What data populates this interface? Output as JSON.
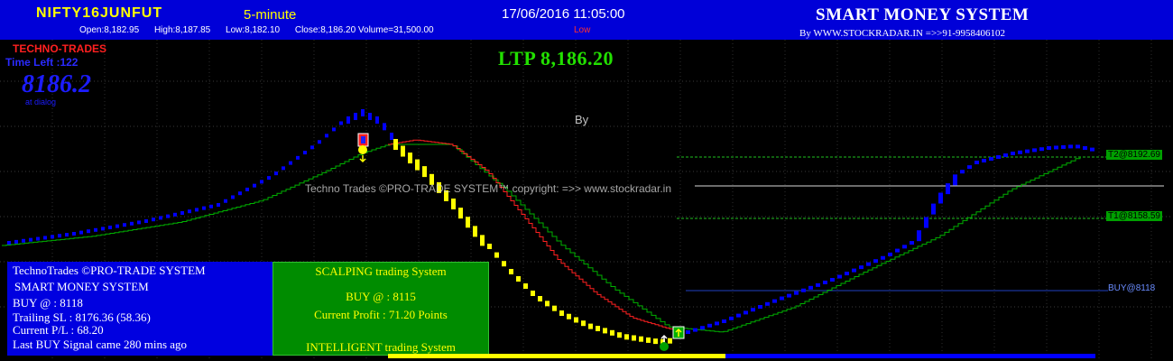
{
  "header": {
    "symbol": "NIFTY16JUNFUT",
    "timeframe": "5-minute",
    "datetime": "17/06/2016 11:05:00",
    "brand": "SMART MONEY SYSTEM",
    "open": "Open:8,182.95",
    "high": "High:8,187.85",
    "low": "Low:8,182.10",
    "close_volume": "Close:8,186.20 Volume=31,500.00",
    "low_tag": "Low",
    "website": "By WWW.STOCKRADAR.IN =>>91-9958406102"
  },
  "overlay": {
    "techno_trades": "TECHNO-TRADES",
    "time_left": "Time Left :122",
    "big_price": "8186.2",
    "small_tag": "at dialog",
    "ltp": "LTP 8,186.20",
    "by_label": "By",
    "copyright": "Techno Trades ©PRO-TRADE SYSTEM™ copyright: =>> www.stockradar.in"
  },
  "levels": {
    "t2": "T2@8192.69",
    "t1": "T1@8158.59",
    "buy": "BUY@8118"
  },
  "panel_left": {
    "line1": "TechnoTrades ©PRO-TRADE SYSTEM",
    "line2": "SMART MONEY SYSTEM",
    "line3": "BUY @ : 8118",
    "line4": "Trailing SL : 8176.36 (58.36)",
    "line5": "Current P/L : 68.20",
    "line6": "Last BUY Signal came 280 mins ago"
  },
  "panel_mid": {
    "line1": "SCALPING trading System",
    "line2": "BUY @ : 8115",
    "line3": "Current Profit : 71.20 Points",
    "line4": "INTELLIGENT trading System"
  },
  "colors": {
    "header_bg": "#0000d8",
    "ma_blue": "#0000ff",
    "ma_yellow": "#ffff00",
    "trail_green": "#00b000",
    "signal_red": "#ff2020"
  },
  "chart_data": {
    "type": "line",
    "title": "",
    "xlabel": "",
    "ylabel": "",
    "grid": true,
    "series": [],
    "levels": [
      {
        "label": "T2@8192.69",
        "value": 8192.69
      },
      {
        "label": "T1@8158.59",
        "value": 8158.59
      },
      {
        "label": "BUY@8118",
        "value": 8118
      }
    ]
  }
}
